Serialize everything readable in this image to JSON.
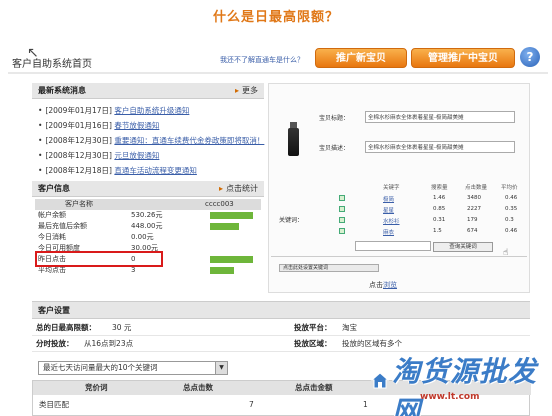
{
  "question_title": "什么是日最高限额？",
  "header": {
    "title": "客户自助系统首页",
    "help_link": "我还不了解直通车是什么？",
    "btn_new": "推广新宝贝",
    "btn_manage": "管理推广中宝贝",
    "help_icon": "?"
  },
  "news": {
    "title": "最新系统消息",
    "more": "更多",
    "items": [
      {
        "date": "[2009年01月17日]",
        "title": "客户自助系统升级通知"
      },
      {
        "date": "[2009年01月16日]",
        "title": "春节放假通知"
      },
      {
        "date": "[2008年12月30日]",
        "title": "重要通知：直通车续费代金券政策即将取消！"
      },
      {
        "date": "[2008年12月30日]",
        "title": "元旦放假通知"
      },
      {
        "date": "[2008年12月18日]",
        "title": "直通车活动流程变更通知"
      }
    ]
  },
  "info": {
    "title": "客户信息",
    "stats_link": "点击统计",
    "header_label": "客户名称",
    "header_value": "cccc003",
    "rows": [
      {
        "label": "帐户余额",
        "value": "530.26元",
        "bar": 0.9
      },
      {
        "label": "最后充值后余额",
        "value": "448.00元",
        "bar": 0.6
      },
      {
        "label": "今日消耗",
        "value": "0.00元",
        "bar": 0
      },
      {
        "label": "今日可用额度",
        "value": "30.00元",
        "bar": 0
      },
      {
        "label": "昨日点击",
        "value": "0",
        "bar": 0.9
      },
      {
        "label": "平均点击",
        "value": "3",
        "bar": 0.5
      }
    ]
  },
  "preview": {
    "label_title": "宝贝标题：",
    "title_value": "全棉水杉麻衣全体裹着星星-极简甜美摊",
    "label_desc": "宝贝描述：",
    "desc_value": "全棉水杉麻衣全体裹着星星-极简甜美摊",
    "kw_label": "关键词：",
    "table_header": [
      "关键字",
      "搜索量",
      "点击数量",
      "平均价"
    ],
    "rows": [
      {
        "kw": "极简",
        "a": "1.46",
        "b": "3480",
        "c": "0.46"
      },
      {
        "kw": "星星",
        "a": "0.85",
        "b": "2227",
        "c": "0.35"
      },
      {
        "kw": "水杉衫",
        "a": "0.31",
        "b": "179",
        "c": "0.3"
      },
      {
        "kw": "麻衣",
        "a": "1.5",
        "b": "674",
        "c": "0.46"
      }
    ],
    "search_btn": "查询关键词",
    "scroll_text": "点击此处设置关键词",
    "caption_pre": "点击",
    "caption_link": "浏览"
  },
  "settings": {
    "title": "客户设置",
    "daily_limit_label": "总的日最高限额：",
    "daily_limit_value": "30 元",
    "platform_label": "投放平台：",
    "platform_value": "淘宝",
    "timeslot_label": "分时投放：",
    "timeslot_value": "从16点到23点",
    "region_label": "投放区域：",
    "region_value": "投放的区域有多个"
  },
  "bottom": {
    "select_value": "最近七天访问量最大的10个关键词",
    "col_keyword": "竞价词",
    "col_clicks": "总点击数",
    "col_amount": "总点击金额",
    "row_keyword": "类目匹配",
    "row_clicks": "7",
    "row_amount": "1"
  },
  "watermark": {
    "text": "淘货源批发网",
    "url": "www.lt.com"
  },
  "colors": {
    "accent_orange": "#e8760f",
    "highlight_red": "#d91a1a",
    "link_blue": "#3a5ea8",
    "bar_green": "#6eb63a"
  },
  "icons": {
    "help": "help-circle-icon",
    "more": "triangle-right-icon",
    "cursor": "mouse-pointer-icon",
    "house": "house-icon"
  }
}
